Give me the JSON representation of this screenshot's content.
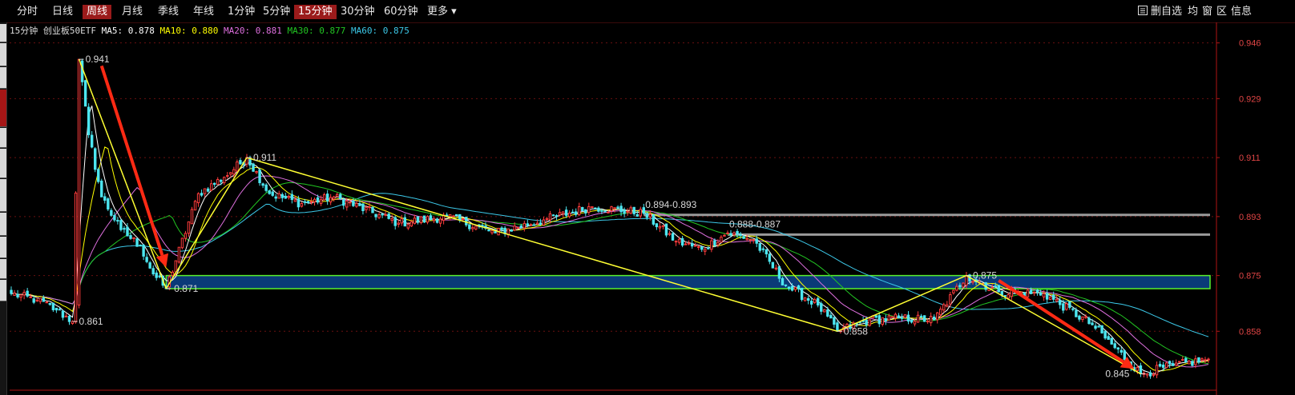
{
  "toolbar": {
    "tabs": [
      "分时",
      "日线",
      "周线",
      "月线",
      "季线",
      "年线",
      "1分钟",
      "5分钟",
      "15分钟",
      "30分钟",
      "60分钟",
      "更多"
    ],
    "active_tab": "周线",
    "highlight_tab": "15分钟",
    "more_arrow": "▾",
    "right_tools": [
      "删自选",
      "均",
      "窗",
      "区",
      "信息"
    ]
  },
  "info": {
    "period": "15分钟",
    "name": "创业板50ETF",
    "ma5_label": "MA5:",
    "ma5_value": "0.878",
    "ma10_label": "MA10:",
    "ma10_value": "0.880",
    "ma20_label": "MA20:",
    "ma20_value": "0.881",
    "ma30_label": "MA30:",
    "ma30_value": "0.877",
    "ma60_label": "MA60:",
    "ma60_value": "0.875"
  },
  "colors": {
    "up": "#ff3c3c",
    "down": "#4ce6f0",
    "axis": "#b01515",
    "ma5": "#ffffff",
    "ma10": "#ffff00",
    "ma20": "#e070e0",
    "ma30": "#22c522",
    "ma60": "#3cc8e8",
    "trendline": "#ffff33",
    "arrow": "#ff2a14",
    "zone": "#0a3a78",
    "zone_border": "#5af02a",
    "level": "#9a9a9a"
  },
  "chart_data": {
    "type": "candlestick",
    "title": "15分钟 创业板50ETF",
    "y_ticks": [
      0.946,
      0.929,
      0.911,
      0.893,
      0.875,
      0.858
    ],
    "ylim": [
      0.8405,
      0.9508
    ],
    "bar_count": 372,
    "annotations": [
      {
        "text": "0.941",
        "bar": 21,
        "price": 0.941,
        "kind": "high"
      },
      {
        "text": "0.861",
        "bar": 19,
        "price": 0.861,
        "kind": "low"
      },
      {
        "text": "0.911",
        "bar": 73,
        "price": 0.911,
        "kind": "high"
      },
      {
        "text": "0.871",
        "bar": 48,
        "price": 0.871,
        "kind": "low"
      },
      {
        "text": "0.894-0.893",
        "bar": 196,
        "price": 0.894,
        "kind": "level"
      },
      {
        "text": "0.888-0.887",
        "bar": 222,
        "price": 0.888,
        "kind": "level"
      },
      {
        "text": "0.875",
        "bar": 296,
        "price": 0.875,
        "kind": "high"
      },
      {
        "text": "0.858",
        "bar": 256,
        "price": 0.858,
        "kind": "low"
      },
      {
        "text": "0.845",
        "bar": 350,
        "price": 0.845,
        "kind": "low"
      }
    ],
    "trendlines": [
      {
        "from": {
          "bar": 21,
          "price": 0.941
        },
        "to": {
          "bar": 48,
          "price": 0.871
        }
      },
      {
        "from": {
          "bar": 48,
          "price": 0.871
        },
        "to": {
          "bar": 73,
          "price": 0.911
        }
      },
      {
        "from": {
          "bar": 73,
          "price": 0.911
        },
        "to": {
          "bar": 256,
          "price": 0.858
        }
      },
      {
        "from": {
          "bar": 256,
          "price": 0.858
        },
        "to": {
          "bar": 296,
          "price": 0.875
        }
      },
      {
        "from": {
          "bar": 296,
          "price": 0.875
        },
        "to": {
          "bar": 350,
          "price": 0.845
        }
      }
    ],
    "zone": {
      "from_bar": 48,
      "low": 0.871,
      "high": 0.875
    },
    "levels": [
      {
        "from_bar": 196,
        "price": 0.8935
      },
      {
        "from_bar": 222,
        "price": 0.8875
      }
    ],
    "arrows": [
      {
        "from": {
          "bar": 28,
          "price": 0.939
        },
        "to": {
          "bar": 48,
          "price": 0.8775
        }
      },
      {
        "from": {
          "bar": 306,
          "price": 0.8735
        },
        "to": {
          "bar": 348,
          "price": 0.8465
        }
      }
    ],
    "ma_last": {
      "MA5": 0.878,
      "MA10": 0.88,
      "MA20": 0.881,
      "MA30": 0.877,
      "MA60": 0.875
    }
  }
}
